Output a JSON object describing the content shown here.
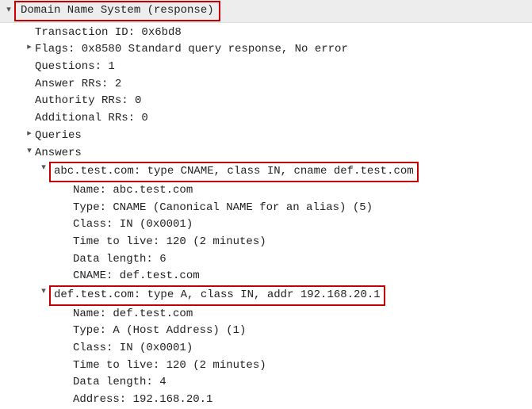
{
  "root": {
    "label": "Domain Name System (response)"
  },
  "fields": {
    "transaction_id": "Transaction ID: 0x6bd8",
    "flags": "Flags: 0x8580 Standard query response, No error",
    "questions": "Questions: 1",
    "answer_rrs": "Answer RRs: 2",
    "authority_rrs": "Authority RRs: 0",
    "additional_rrs": "Additional RRs: 0",
    "queries": "Queries",
    "answers": "Answers"
  },
  "answers": [
    {
      "summary": "abc.test.com: type CNAME, class IN, cname def.test.com",
      "name": "Name: abc.test.com",
      "type": "Type: CNAME (Canonical NAME for an alias) (5)",
      "class": "Class: IN (0x0001)",
      "ttl": "Time to live: 120 (2 minutes)",
      "data_length": "Data length: 6",
      "value_label": "CNAME: def.test.com"
    },
    {
      "summary": "def.test.com: type A, class IN, addr 192.168.20.1",
      "name": "Name: def.test.com",
      "type": "Type: A (Host Address) (1)",
      "class": "Class: IN (0x0001)",
      "ttl": "Time to live: 120 (2 minutes)",
      "data_length": "Data length: 4",
      "value_label": "Address: 192.168.20.1"
    }
  ]
}
